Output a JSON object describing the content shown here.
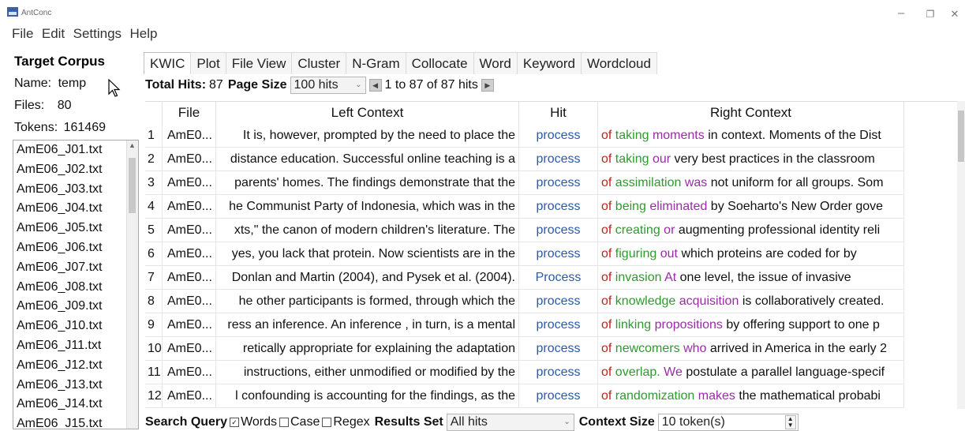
{
  "window": {
    "title": "AntConc",
    "min_label": "–",
    "max_label": "❐",
    "close_label": "✕"
  },
  "menu": [
    "File",
    "Edit",
    "Settings",
    "Help"
  ],
  "corpus": {
    "heading": "Target Corpus",
    "name_label": "Name:",
    "name_value": "temp",
    "files_label": "Files:",
    "files_value": "80",
    "tokens_label": "Tokens:",
    "tokens_value": "161469",
    "files": [
      "AmE06_J01.txt",
      "AmE06_J02.txt",
      "AmE06_J03.txt",
      "AmE06_J04.txt",
      "AmE06_J05.txt",
      "AmE06_J06.txt",
      "AmE06_J07.txt",
      "AmE06_J08.txt",
      "AmE06_J09.txt",
      "AmE06_J10.txt",
      "AmE06_J11.txt",
      "AmE06_J12.txt",
      "AmE06_J13.txt",
      "AmE06_J14.txt",
      "AmE06_J15.txt"
    ]
  },
  "tabs": [
    "KWIC",
    "Plot",
    "File View",
    "Cluster",
    "N-Gram",
    "Collocate",
    "Word",
    "Keyword",
    "Wordcloud"
  ],
  "active_tab": "KWIC",
  "hits": {
    "total_label": "Total Hits:",
    "total_value": "87",
    "page_size_label": "Page Size",
    "page_size_value": "100 hits",
    "range_text": "1 to 87 of 87 hits"
  },
  "table": {
    "headers": {
      "num": "",
      "file": "File",
      "left": "Left Context",
      "hit": "Hit",
      "right": "Right Context"
    },
    "rows": [
      {
        "n": "1",
        "file": "AmE0...",
        "left": "It is, however, prompted by the need to place the",
        "hit": "process",
        "r1": "of",
        "r2": "taking",
        "r3": "moments",
        "r4": "in context. Moments of the Dist"
      },
      {
        "n": "2",
        "file": "AmE0...",
        "left": "distance education. Successful online teaching is a",
        "hit": "process",
        "r1": "of",
        "r2": "taking",
        "r3": "our",
        "r4": "very best practices in the classroom"
      },
      {
        "n": "3",
        "file": "AmE0...",
        "left": "parents' homes. The findings demonstrate that the",
        "hit": "process",
        "r1": "of",
        "r2": "assimilation",
        "r3": "was",
        "r4": "not uniform for all groups. Som"
      },
      {
        "n": "4",
        "file": "AmE0...",
        "left": "he Communist Party of Indonesia, which was in the",
        "hit": "process",
        "r1": "of",
        "r2": "being",
        "r3": "eliminated",
        "r4": "by Soeharto's New Order gove"
      },
      {
        "n": "5",
        "file": "AmE0...",
        "left": "xts,\" the canon of modern children's literature. The",
        "hit": "process",
        "r1": "of",
        "r2": "creating",
        "r3": "or",
        "r4": "augmenting professional identity reli"
      },
      {
        "n": "6",
        "file": "AmE0...",
        "left": "yes, you lack that protein. Now scientists are in the",
        "hit": "process",
        "r1": "of",
        "r2": "figuring",
        "r3": "out",
        "r4": "which proteins are coded for by"
      },
      {
        "n": "7",
        "file": "AmE0...",
        "left": "Donlan and Martin (2004), and Pysek et al. (2004).",
        "hit": "Process",
        "r1": "of",
        "r2": "invasion",
        "r3": "At",
        "r4": "one level, the issue of invasive"
      },
      {
        "n": "8",
        "file": "AmE0...",
        "left": "he other participants is formed, through which the",
        "hit": "process",
        "r1": "of",
        "r2": "knowledge",
        "r3": "acquisition",
        "r4": "is collaboratively created."
      },
      {
        "n": "9",
        "file": "AmE0...",
        "left": "ress an inference. An inference , in turn, is a mental",
        "hit": "process",
        "r1": "of",
        "r2": "linking",
        "r3": "propositions",
        "r4": "by offering support to one p"
      },
      {
        "n": "10",
        "file": "AmE0...",
        "left": "retically appropriate for explaining the adaptation",
        "hit": "process",
        "r1": "of",
        "r2": "newcomers",
        "r3": "who",
        "r4": "arrived in America in the early 2"
      },
      {
        "n": "11",
        "file": "AmE0...",
        "left": "instructions, either unmodified or modified by the",
        "hit": "process",
        "r1": "of",
        "r2": "overlap.",
        "r3": "We",
        "r4": "postulate a parallel language-specif"
      },
      {
        "n": "12",
        "file": "AmE0...",
        "left": "l confounding is accounting for the findings, as the",
        "hit": "process",
        "r1": "of",
        "r2": "randomization",
        "r3": "makes",
        "r4": "the mathematical probabi"
      }
    ]
  },
  "bottom": {
    "search_query_label": "Search Query",
    "words_label": "Words",
    "case_label": "Case",
    "regex_label": "Regex",
    "results_set_label": "Results Set",
    "results_set_value": "All hits",
    "context_size_label": "Context Size",
    "context_size_value": "10 token(s)"
  }
}
